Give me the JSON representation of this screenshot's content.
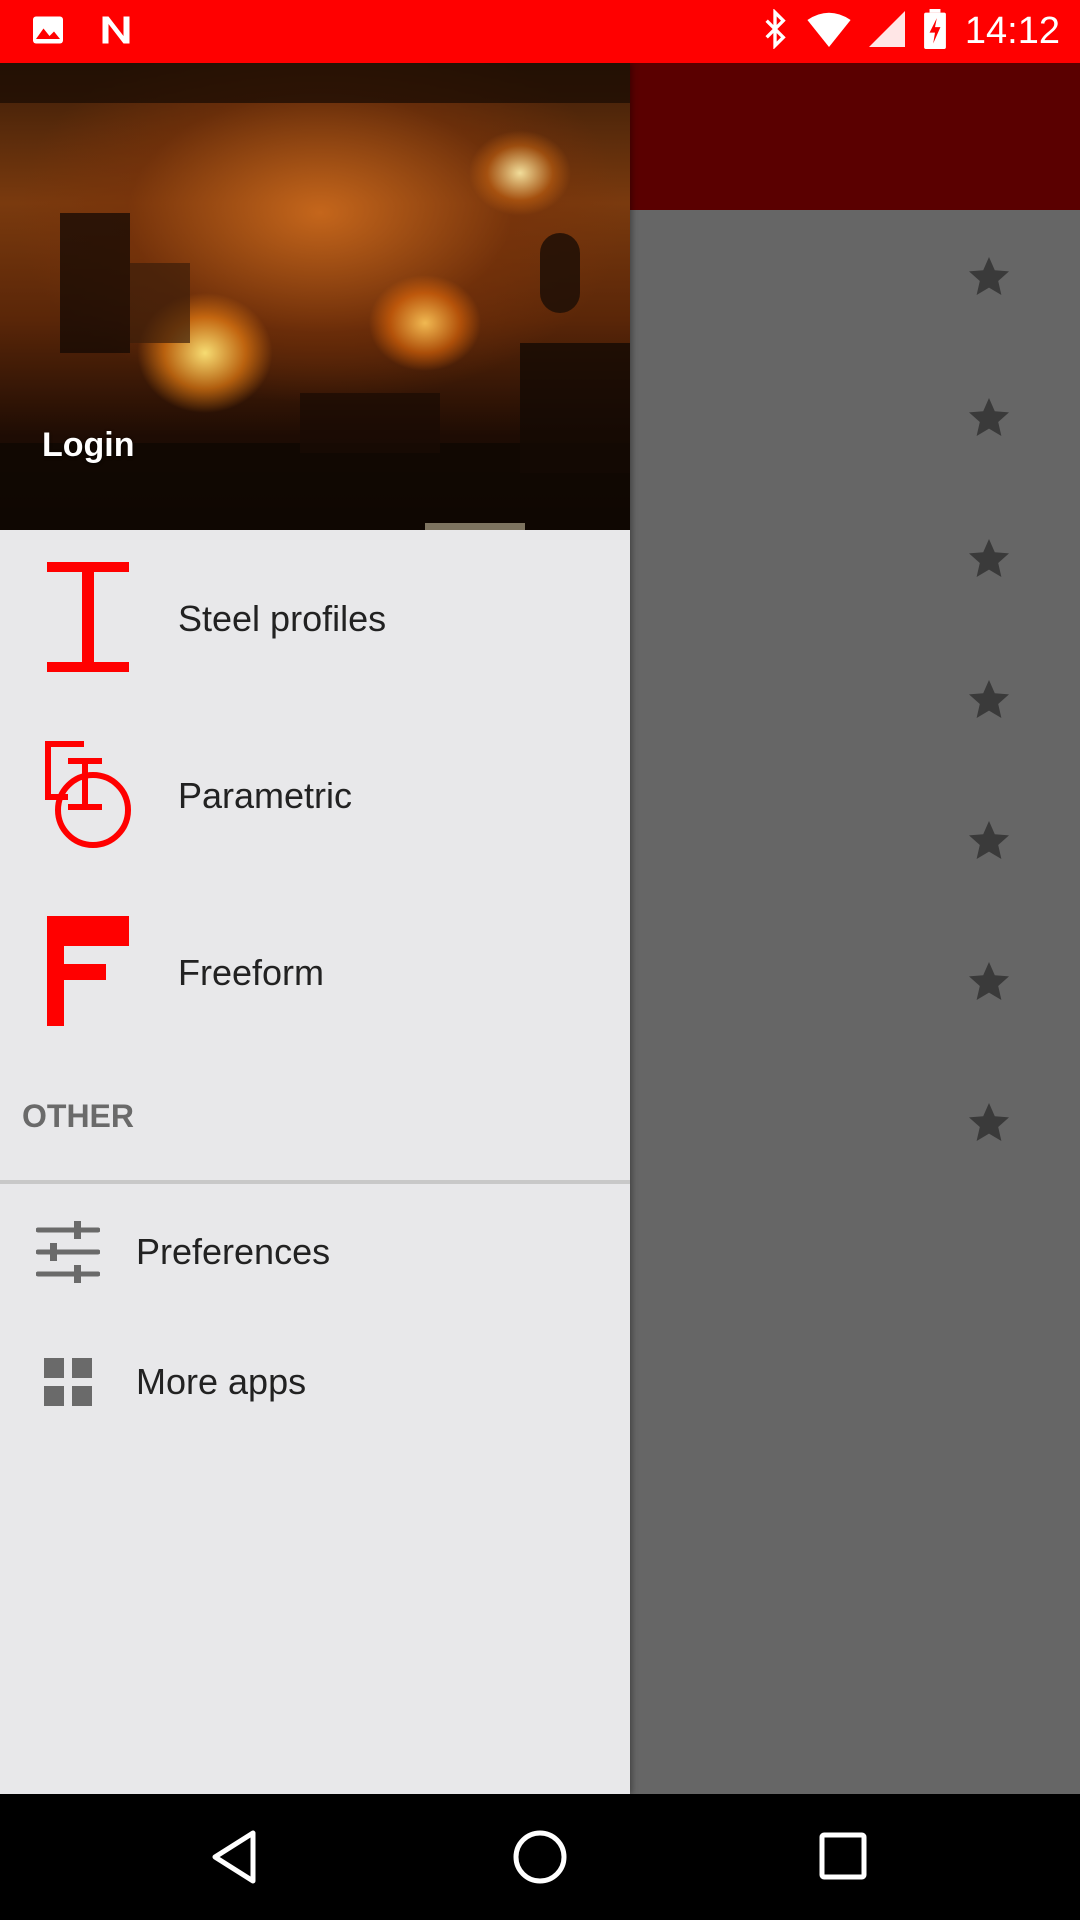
{
  "status_bar": {
    "time": "14:12",
    "icons": [
      "image-icon",
      "n-logo-icon",
      "bluetooth-icon",
      "wifi-icon",
      "cell-signal-icon",
      "battery-charging-icon"
    ],
    "color": "#ff0000"
  },
  "drawer": {
    "header": {
      "login_label": "Login"
    },
    "items": [
      {
        "label": "Steel profiles",
        "icon": "i-beam-icon"
      },
      {
        "label": "Parametric",
        "icon": "parametric-icon"
      },
      {
        "label": "Freeform",
        "icon": "freeform-f-icon"
      }
    ],
    "section_header": "OTHER",
    "other_items": [
      {
        "label": "Preferences",
        "icon": "sliders-icon"
      },
      {
        "label": "More apps",
        "icon": "grid-apps-icon"
      }
    ],
    "accent_color": "#ff0000"
  },
  "background_app": {
    "appbar_color": "#e00000",
    "favorite_icon": "star-icon",
    "favorite_count": 7
  },
  "nav_bar": {
    "buttons": [
      "back-icon",
      "home-icon",
      "recents-icon"
    ]
  }
}
